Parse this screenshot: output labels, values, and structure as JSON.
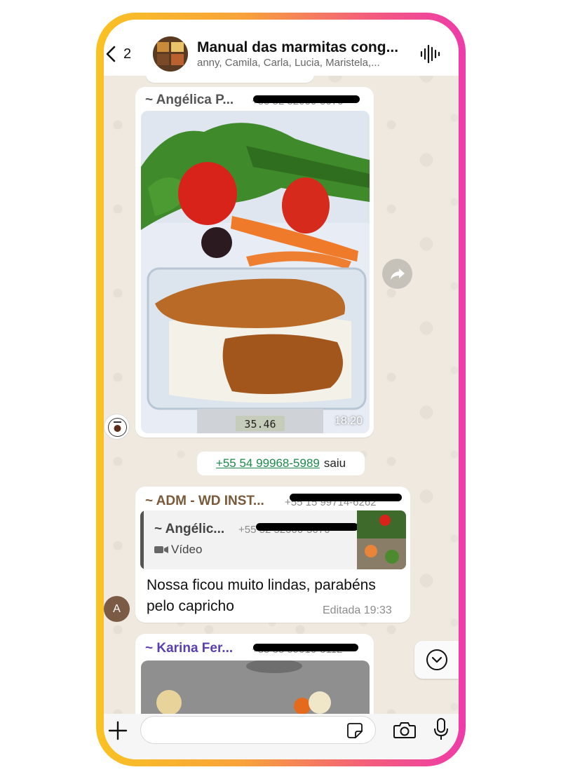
{
  "header": {
    "back_count": "2",
    "title": "Manual das marmitas cong...",
    "subtitle": "anny, Camila, Carla, Lucia, Maristela,..."
  },
  "messages": [
    {
      "sender": "~ Angélica P...",
      "phone": "+55 52 52000-5070",
      "type": "photo",
      "time": "18:20",
      "scale_reading": "35.46"
    },
    {
      "system": true,
      "link": "+55 54 99968-5989",
      "text": "saiu"
    },
    {
      "sender": "~ ADM - WD INST...",
      "phone": "+55 15 99714-6262",
      "avatar_letter": "A",
      "quote": {
        "sender": "~ Angélic...",
        "phone": "+55 52 52000-5070",
        "type": "Vídeo"
      },
      "text": "Nossa ficou muito lindas, parabéns pelo capricho",
      "time": "Editada 19:33"
    },
    {
      "sender": "~ Karina Fer...",
      "phone": "+55 35 99010-3112",
      "type": "photo"
    }
  ],
  "colors": {
    "sender_1": "#555555",
    "sender_2": "#7a5a3a",
    "sender_3": "#5a3fb0",
    "system_link": "#1b8a4a"
  },
  "icons": {
    "back": "chevron-left-icon",
    "wave": "audio-wave-icon",
    "forward": "forward-icon",
    "scroll": "chevron-down-circle-icon",
    "plus": "plus-icon",
    "sticker": "sticker-icon",
    "camera": "camera-icon",
    "mic": "microphone-icon"
  }
}
